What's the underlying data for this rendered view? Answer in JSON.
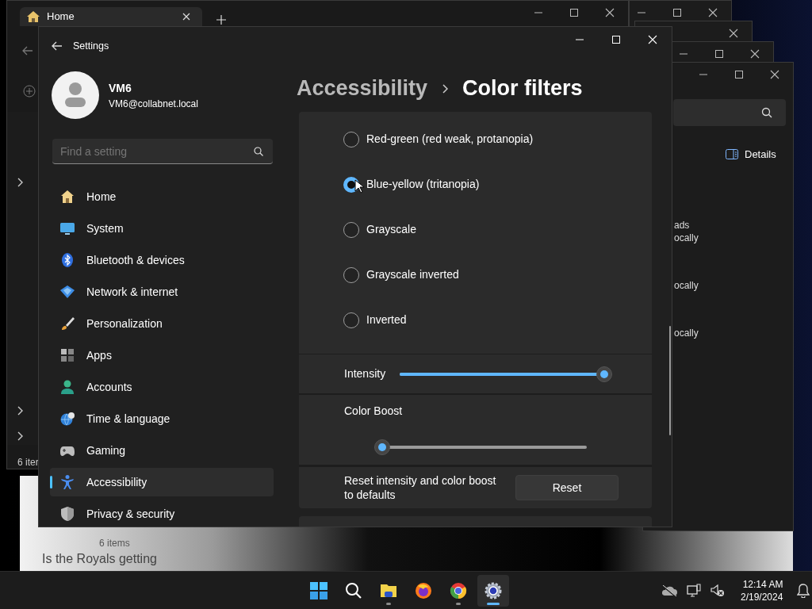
{
  "background_windows": {
    "explorer_tab": {
      "label": "Home"
    },
    "explorer_status": "6 iter",
    "details_button": "Details",
    "file_fragments": [
      "ads",
      "ocally",
      "ocally",
      "ocally"
    ],
    "lower_window": {
      "status": "6 items",
      "caption": "Is the Royals getting"
    }
  },
  "settings": {
    "window": {
      "title": "Settings"
    },
    "account": {
      "name": "VM6",
      "email": "VM6@collabnet.local"
    },
    "search": {
      "placeholder": "Find a setting"
    },
    "nav": [
      {
        "label": "Home",
        "selected": false
      },
      {
        "label": "System",
        "selected": false
      },
      {
        "label": "Bluetooth & devices",
        "selected": false
      },
      {
        "label": "Network & internet",
        "selected": false
      },
      {
        "label": "Personalization",
        "selected": false
      },
      {
        "label": "Apps",
        "selected": false
      },
      {
        "label": "Accounts",
        "selected": false
      },
      {
        "label": "Time & language",
        "selected": false
      },
      {
        "label": "Gaming",
        "selected": false
      },
      {
        "label": "Accessibility",
        "selected": true
      },
      {
        "label": "Privacy & security",
        "selected": false
      }
    ],
    "breadcrumb": {
      "parent": "Accessibility",
      "current": "Color filters"
    },
    "filters": [
      {
        "label": "Red-green (red weak, protanopia)",
        "selected": false
      },
      {
        "label": "Blue-yellow (tritanopia)",
        "selected": true
      },
      {
        "label": "Grayscale",
        "selected": false
      },
      {
        "label": "Grayscale inverted",
        "selected": false
      },
      {
        "label": "Inverted",
        "selected": false
      }
    ],
    "intensity": {
      "label": "Intensity",
      "level": 1
    },
    "color_boost": {
      "label": "Color Boost",
      "level": 0
    },
    "reset": {
      "text": "Reset intensity and color boost to defaults",
      "button": "Reset"
    }
  },
  "taskbar": {
    "apps": [
      {
        "running": true,
        "selected": false
      },
      {
        "running": false,
        "selected": false
      },
      {
        "running": true,
        "selected": false
      },
      {
        "running": true,
        "selected": true
      }
    ],
    "clock": {
      "time": "12:14 AM",
      "date": "2/19/2024"
    }
  }
}
